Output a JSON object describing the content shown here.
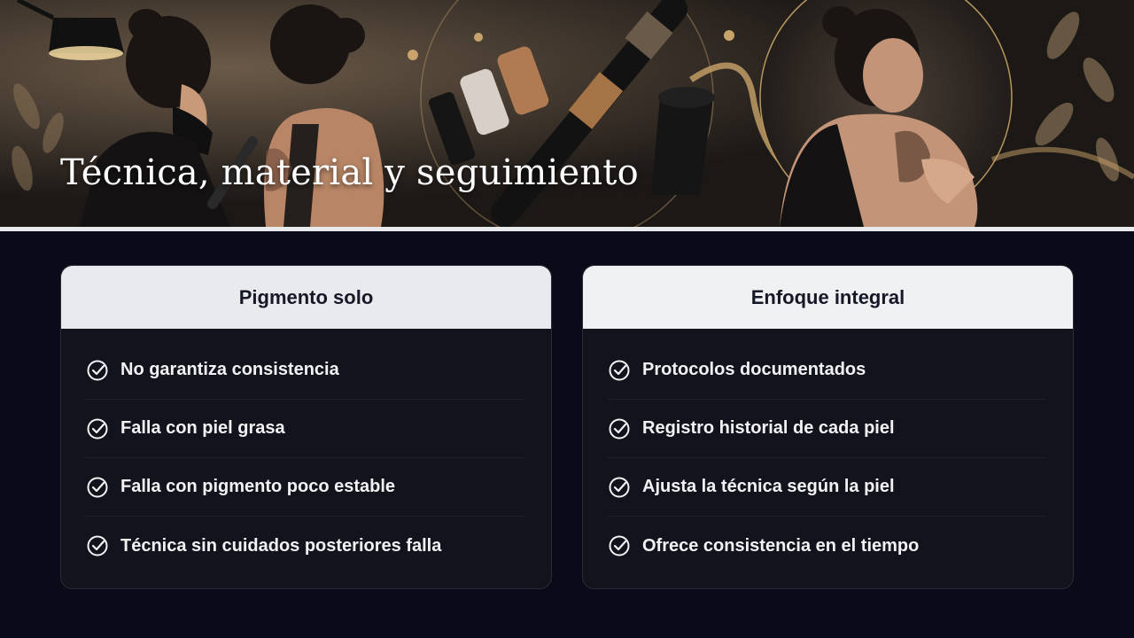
{
  "hero": {
    "title": "Técnica, material y seguimiento",
    "illustration": "tattoo-studio-illustration"
  },
  "cards": [
    {
      "title": "Pigmento solo",
      "icon": "check-circle-icon",
      "items": [
        "No garantiza consistencia",
        "Falla con piel grasa",
        "Falla con pigmento poco estable",
        "Técnica sin cuidados posteriores falla"
      ]
    },
    {
      "title": "Enfoque integral",
      "icon": "check-circle-icon",
      "items": [
        "Protocolos documentados",
        "Registro historial de cada piel",
        "Ajusta la técnica según la piel",
        "Ofrece consistencia en el tiempo"
      ]
    }
  ],
  "colors": {
    "background": "#0a0a19",
    "card": "#12131d",
    "card_header": "#e9eaee",
    "text_light": "#f2f2f5",
    "text_dark": "#151827",
    "accent_gold": "#c9a46a"
  }
}
